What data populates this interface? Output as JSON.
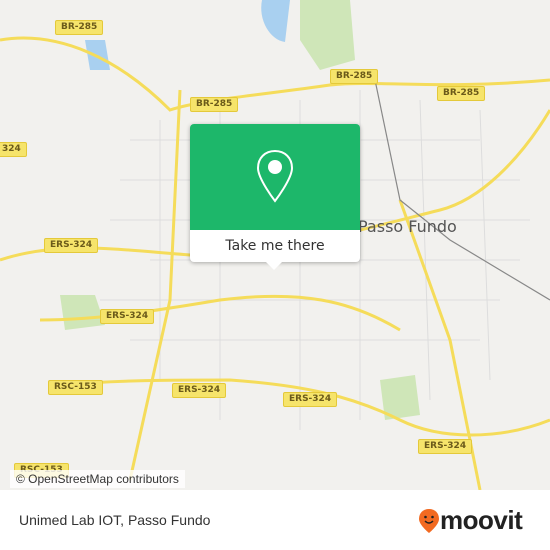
{
  "map": {
    "city_label": "Passo Fundo",
    "road_shields": [
      {
        "label": "BR-285"
      },
      {
        "label": "BR-285"
      },
      {
        "label": "BR-285"
      },
      {
        "label": "BR-285"
      },
      {
        "label": "324"
      },
      {
        "label": "ERS-324"
      },
      {
        "label": "ERS-324"
      },
      {
        "label": "ERS-324"
      },
      {
        "label": "ERS-324"
      },
      {
        "label": "ERS-324"
      },
      {
        "label": "RSC-153"
      },
      {
        "label": "RSC-153"
      }
    ],
    "attribution": "© OpenStreetMap contributors"
  },
  "popup": {
    "icon": "location-pin-icon",
    "button_label": "Take me there",
    "color": "#1db76a"
  },
  "footer": {
    "title": "Unimed Lab IOT, Passo Fundo",
    "logo_text": "moovit",
    "logo_color": "#f26a21"
  }
}
